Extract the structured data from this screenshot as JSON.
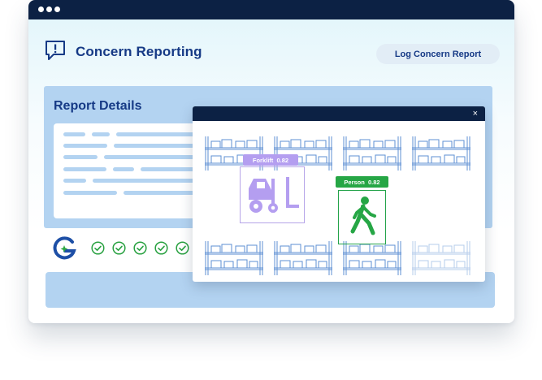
{
  "window": {
    "titlebar_dots": 3
  },
  "header": {
    "title": "Concern Reporting",
    "icon": "report-alert-icon",
    "log_button_label": "Log Concern Report"
  },
  "report": {
    "title": "Report Details"
  },
  "status": {
    "logo": "g-logo-icon",
    "checks": 5,
    "check_icon": "check-circle-icon"
  },
  "modal": {
    "close_label": "×",
    "detections": [
      {
        "label": "Forklift",
        "score": "0.82",
        "icon": "forklift-icon",
        "color": "#b49ef0"
      },
      {
        "label": "Person",
        "score": "0.82",
        "icon": "walking-person-icon",
        "color": "#26a645"
      }
    ]
  },
  "colors": {
    "navy": "#0c2144",
    "accent_blue": "#163a86",
    "panel_blue": "#b3d3f1",
    "check_green": "#27a03f"
  }
}
